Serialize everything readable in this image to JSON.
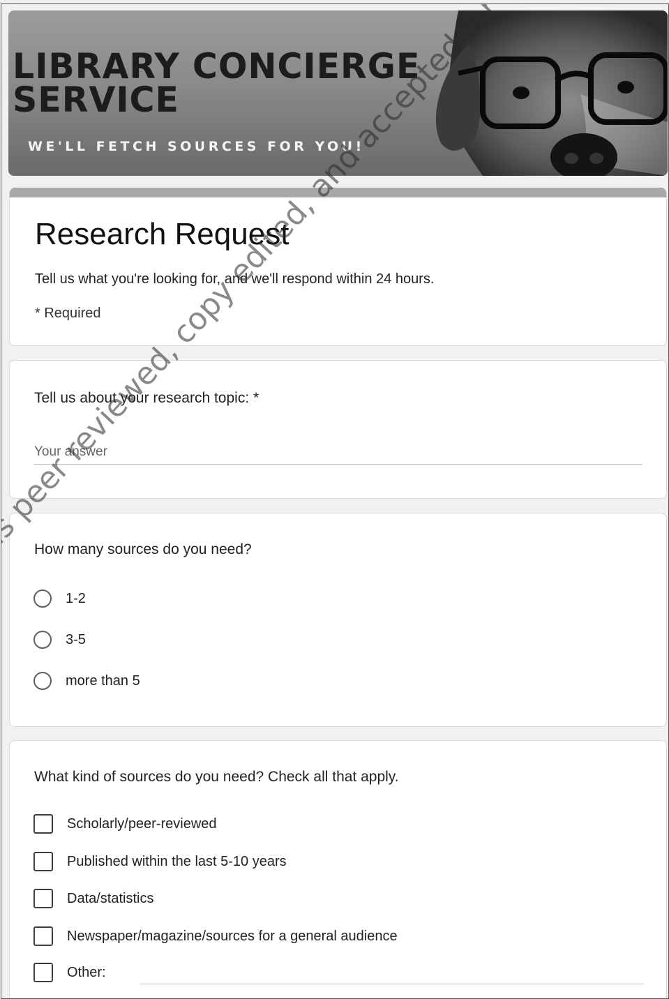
{
  "banner": {
    "title": "LIBRARY CONCIERGE\nSERVICE",
    "tagline": "WE'LL FETCH SOURCES FOR YOU!"
  },
  "form": {
    "title": "Research Request",
    "description": "Tell us what you're looking for, and we'll respond within 24 hours.",
    "required_note": "* Required"
  },
  "questions": {
    "topic": {
      "label": "Tell us about your research topic: *",
      "placeholder": "Your answer"
    },
    "count": {
      "label": "How many sources do you need?",
      "options": [
        "1-2",
        "3-5",
        "more than 5"
      ]
    },
    "kinds": {
      "label": "What kind of sources do you need? Check all that apply.",
      "options": [
        "Scholarly/peer-reviewed",
        "Published within the last 5-10 years",
        "Data/statistics",
        "Newspaper/magazine/sources for a general audience",
        "Other:"
      ]
    }
  },
  "watermark": "... is peer reviewed, copy edited, and accepted for publication, po"
}
